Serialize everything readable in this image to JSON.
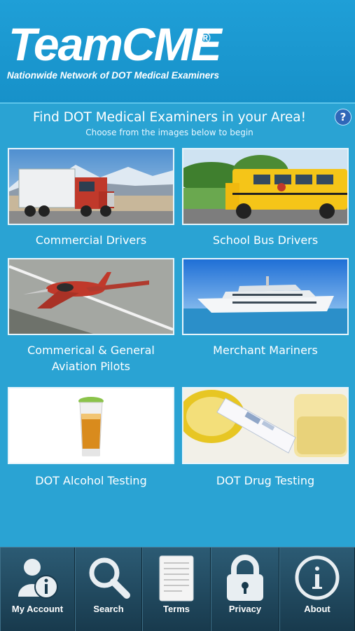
{
  "header": {
    "brand": "TeamCME",
    "registered": "®",
    "tagline": "Nationwide Network of DOT Medical Examiners"
  },
  "intro": {
    "title": "Find DOT Medical Examiners in your Area!",
    "subtitle": "Choose from the images below to begin",
    "help": "?"
  },
  "tiles": [
    {
      "label": "Commercial Drivers",
      "icon": "semi-truck-image"
    },
    {
      "label": "School Bus Drivers",
      "icon": "school-bus-image"
    },
    {
      "label": "Commerical & General Aviation Pilots",
      "icon": "airplane-image"
    },
    {
      "label": "Merchant Mariners",
      "icon": "yacht-image"
    },
    {
      "label": "DOT Alcohol Testing",
      "icon": "alcohol-glass-image"
    },
    {
      "label": "DOT Drug Testing",
      "icon": "drug-test-image"
    }
  ],
  "tabs": [
    {
      "label": "My Account",
      "icon": "account-icon"
    },
    {
      "label": "Search",
      "icon": "search-icon"
    },
    {
      "label": "Terms",
      "icon": "terms-icon"
    },
    {
      "label": "Privacy",
      "icon": "lock-icon"
    },
    {
      "label": "About",
      "icon": "info-icon"
    }
  ],
  "colors": {
    "background": "#2aa3d3",
    "header": "#1f9fd7",
    "footer": "#183a4d"
  }
}
